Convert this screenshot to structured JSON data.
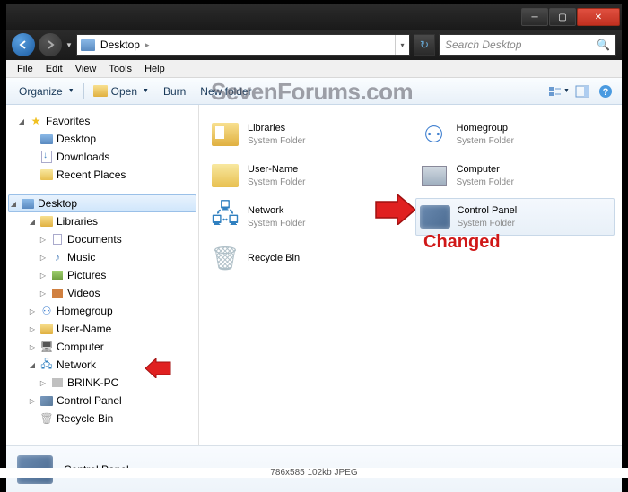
{
  "watermark": "SevenForums.com",
  "caption": "786x585   102kb   JPEG",
  "address": {
    "location": "Desktop",
    "separator": "▸"
  },
  "search": {
    "placeholder": "Search Desktop"
  },
  "menu": {
    "file": "File",
    "edit": "Edit",
    "view": "View",
    "tools": "Tools",
    "help": "Help"
  },
  "toolbar": {
    "organize": "Organize",
    "open": "Open",
    "burn": "Burn",
    "newfolder": "New folder"
  },
  "sidebar": {
    "favorites": "Favorites",
    "fav_items": {
      "desktop": "Desktop",
      "downloads": "Downloads",
      "recent": "Recent Places"
    },
    "desktop": "Desktop",
    "libraries": "Libraries",
    "lib_items": {
      "documents": "Documents",
      "music": "Music",
      "pictures": "Pictures",
      "videos": "Videos"
    },
    "homegroup": "Homegroup",
    "username": "User-Name",
    "computer": "Computer",
    "network": "Network",
    "net_items": {
      "pc": "BRINK-PC"
    },
    "cpanel": "Control Panel",
    "recycle": "Recycle Bin"
  },
  "content": {
    "system_folder": "System Folder",
    "items": {
      "libraries": "Libraries",
      "username": "User-Name",
      "network": "Network",
      "recycle": "Recycle Bin",
      "homegroup": "Homegroup",
      "computer": "Computer",
      "cpanel": "Control Panel"
    }
  },
  "details": {
    "title": "Control Panel"
  },
  "annotation": {
    "changed": "Changed"
  }
}
